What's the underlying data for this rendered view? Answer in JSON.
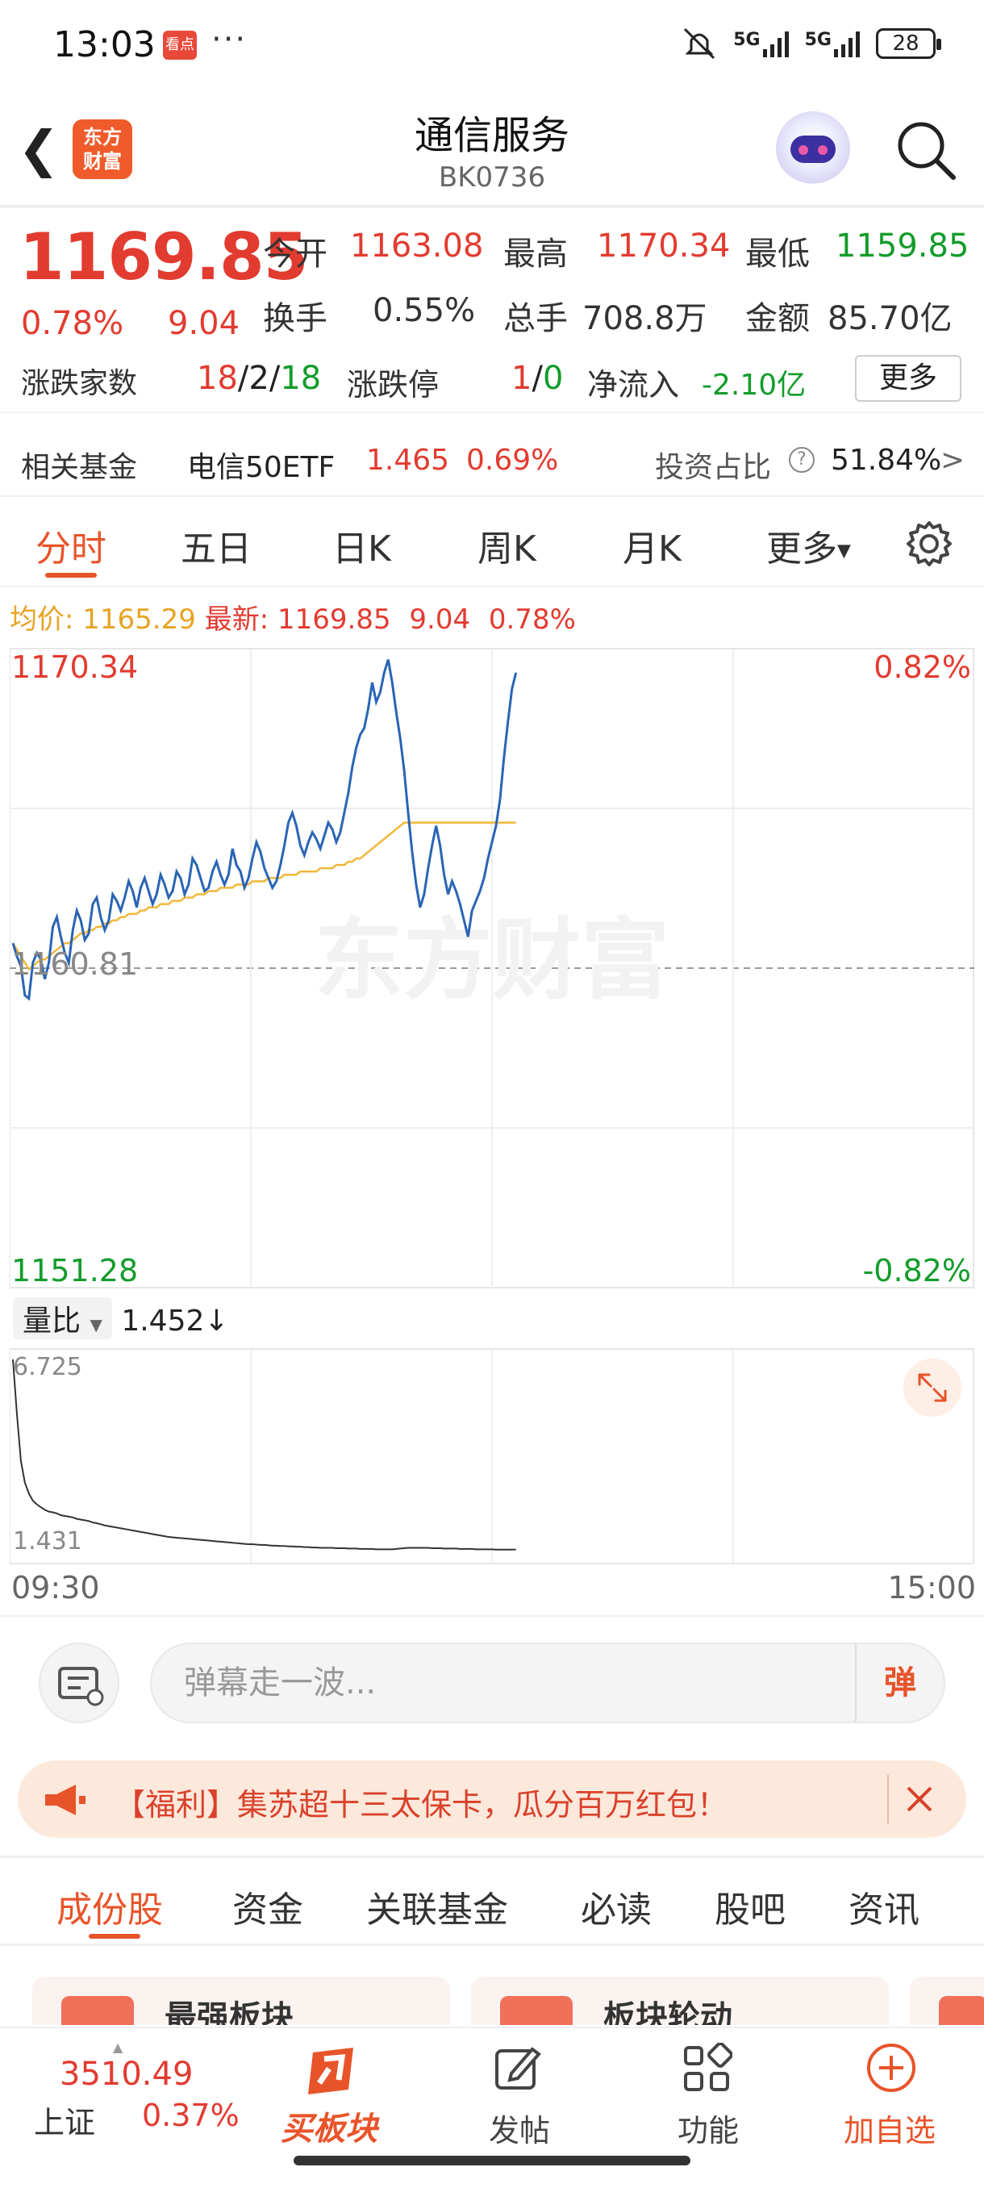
{
  "status_bar": {
    "time": "13:03",
    "app_icon_text": "看点",
    "more": "···",
    "signal1": "5G",
    "signal2": "5G",
    "battery": "28"
  },
  "header": {
    "title": "通信服务",
    "code": "BK0736",
    "logo_line1": "东方",
    "logo_line2": "财富"
  },
  "quote": {
    "price": "1169.85",
    "change_pct": "0.78%",
    "change": "9.04",
    "open_label": "今开",
    "open": "1163.08",
    "high_label": "最高",
    "high": "1170.34",
    "low_label": "最低",
    "low": "1159.85",
    "turnover_label": "换手",
    "turnover": "0.55%",
    "volume_label": "总手",
    "volume": "708.8万",
    "amount_label": "金额",
    "amount": "85.70亿",
    "breadth_label": "涨跌家数",
    "up_count": "18",
    "flat_count": "2",
    "down_count": "18",
    "limit_label": "涨跌停",
    "limit_up": "1",
    "limit_down": "0",
    "netflow_label": "净流入",
    "netflow": "-2.10亿",
    "more_label": "更多"
  },
  "fund": {
    "label": "相关基金",
    "name": "电信50ETF",
    "price": "1.465",
    "pct": "0.69%",
    "ratio_label": "投资占比",
    "ratio": "51.84%",
    "arrow": ">"
  },
  "tabs": [
    "分时",
    "五日",
    "日K",
    "周K",
    "月K",
    "更多"
  ],
  "legend": {
    "avg_label": "均价:",
    "avg": "1165.29",
    "last_label": "最新:",
    "last": "1169.85",
    "change": "9.04",
    "pct": "0.78%"
  },
  "chart_data": {
    "type": "line",
    "ylim": [
      1151.28,
      1170.34
    ],
    "ytick_top": "1170.34",
    "ytick_mid": "1160.81",
    "ytick_bottom": "1151.28",
    "pct_top": "0.82%",
    "pct_bottom": "-0.82%",
    "watermark": "东方财富",
    "x_start": "09:30",
    "x_end": "15:00",
    "total_minutes": 240,
    "series": [
      {
        "values": [
          1161.6,
          1161.2,
          1160.9,
          1160.0,
          1159.9,
          1161.0,
          1161.3,
          1161.1,
          1160.5,
          1161.0,
          1162.1,
          1162.4,
          1161.8,
          1161.3,
          1161.0,
          1162.0,
          1162.6,
          1162.3,
          1161.7,
          1161.9,
          1162.8,
          1163.0,
          1162.4,
          1162.0,
          1162.3,
          1163.1,
          1162.9,
          1162.6,
          1163.0,
          1163.5,
          1163.2,
          1162.7,
          1163.3,
          1163.6,
          1163.2,
          1162.8,
          1163.1,
          1163.7,
          1163.4,
          1163.0,
          1163.2,
          1163.8,
          1163.6,
          1163.1,
          1163.4,
          1164.2,
          1164.0,
          1163.6,
          1163.2,
          1163.3,
          1163.8,
          1164.1,
          1163.7,
          1163.4,
          1163.7,
          1164.5,
          1164.0,
          1163.8,
          1163.3,
          1163.6,
          1164.2,
          1164.7,
          1164.4,
          1163.9,
          1163.6,
          1163.3,
          1163.5,
          1164.0,
          1164.6,
          1165.3,
          1165.6,
          1165.2,
          1164.6,
          1164.3,
          1164.7,
          1165.0,
          1164.8,
          1164.5,
          1164.9,
          1165.3,
          1165.1,
          1164.7,
          1165.0,
          1165.6,
          1166.2,
          1167.0,
          1167.6,
          1168.0,
          1168.2,
          1168.8,
          1169.6,
          1169.0,
          1169.3,
          1169.9,
          1170.3,
          1169.6,
          1168.7,
          1167.9,
          1166.9,
          1165.6,
          1164.4,
          1163.4,
          1162.7,
          1163.1,
          1163.9,
          1164.6,
          1165.2,
          1164.6,
          1163.7,
          1163.1,
          1163.5,
          1163.2,
          1162.8,
          1162.3,
          1161.8,
          1162.6,
          1162.9,
          1163.2,
          1163.6,
          1164.2,
          1164.7,
          1165.2,
          1166.0,
          1167.3,
          1168.4,
          1169.4,
          1169.9
        ],
        "color": "#2a64b5"
      },
      {
        "name_hidden": true,
        "values": [
          1161.6,
          1161.4,
          1161.2,
          1161.0,
          1160.8,
          1160.9,
          1161.0,
          1161.1,
          1161.1,
          1161.2,
          1161.3,
          1161.4,
          1161.5,
          1161.6,
          1161.6,
          1161.7,
          1161.8,
          1161.9,
          1161.9,
          1162.0,
          1162.0,
          1162.1,
          1162.1,
          1162.2,
          1162.2,
          1162.3,
          1162.3,
          1162.4,
          1162.4,
          1162.5,
          1162.5,
          1162.5,
          1162.6,
          1162.6,
          1162.7,
          1162.7,
          1162.7,
          1162.8,
          1162.8,
          1162.8,
          1162.9,
          1162.9,
          1162.9,
          1163.0,
          1163.0,
          1163.0,
          1163.1,
          1163.1,
          1163.1,
          1163.2,
          1163.2,
          1163.2,
          1163.3,
          1163.3,
          1163.3,
          1163.3,
          1163.4,
          1163.4,
          1163.4,
          1163.4,
          1163.5,
          1163.5,
          1163.5,
          1163.5,
          1163.6,
          1163.6,
          1163.6,
          1163.6,
          1163.7,
          1163.7,
          1163.7,
          1163.7,
          1163.8,
          1163.8,
          1163.8,
          1163.8,
          1163.8,
          1163.9,
          1163.9,
          1163.9,
          1163.9,
          1164.0,
          1164.0,
          1164.0,
          1164.1,
          1164.1,
          1164.2,
          1164.2,
          1164.3,
          1164.4,
          1164.5,
          1164.6,
          1164.7,
          1164.8,
          1164.9,
          1165.0,
          1165.1,
          1165.2,
          1165.3,
          1165.3,
          1165.3,
          1165.3,
          1165.3,
          1165.3,
          1165.3,
          1165.3,
          1165.3,
          1165.3,
          1165.3,
          1165.3,
          1165.3,
          1165.3,
          1165.3,
          1165.3,
          1165.3,
          1165.3,
          1165.3,
          1165.3,
          1165.3,
          1165.3,
          1165.3,
          1165.3,
          1165.3,
          1165.3,
          1165.3,
          1165.3,
          1165.3
        ],
        "color": "#f0b83a"
      }
    ]
  },
  "volume_ratio": {
    "label": "量比",
    "value": "1.452",
    "arrow": "↓",
    "ytick_top": "6.725",
    "ytick_bottom": "1.431",
    "ylim": [
      1.2,
      6.9
    ],
    "values": [
      6.7,
      5.2,
      3.9,
      3.3,
      3.0,
      2.8,
      2.7,
      2.62,
      2.55,
      2.5,
      2.48,
      2.45,
      2.4,
      2.38,
      2.36,
      2.34,
      2.3,
      2.28,
      2.26,
      2.24,
      2.2,
      2.18,
      2.15,
      2.12,
      2.1,
      2.08,
      2.06,
      2.04,
      2.02,
      2.0,
      1.98,
      1.96,
      1.94,
      1.92,
      1.9,
      1.88,
      1.86,
      1.84,
      1.82,
      1.8,
      1.79,
      1.78,
      1.77,
      1.76,
      1.75,
      1.74,
      1.73,
      1.72,
      1.71,
      1.7,
      1.69,
      1.68,
      1.67,
      1.66,
      1.65,
      1.64,
      1.63,
      1.62,
      1.61,
      1.6,
      1.6,
      1.59,
      1.58,
      1.58,
      1.57,
      1.56,
      1.56,
      1.55,
      1.55,
      1.54,
      1.54,
      1.53,
      1.53,
      1.52,
      1.52,
      1.51,
      1.51,
      1.5,
      1.5,
      1.5,
      1.5,
      1.49,
      1.49,
      1.49,
      1.48,
      1.48,
      1.48,
      1.47,
      1.47,
      1.47,
      1.47,
      1.46,
      1.46,
      1.46,
      1.46,
      1.46,
      1.47,
      1.48,
      1.49,
      1.5,
      1.5,
      1.5,
      1.5,
      1.5,
      1.5,
      1.49,
      1.49,
      1.49,
      1.48,
      1.48,
      1.48,
      1.48,
      1.47,
      1.47,
      1.47,
      1.47,
      1.46,
      1.46,
      1.46,
      1.46,
      1.46,
      1.45,
      1.45,
      1.45,
      1.45,
      1.45,
      1.452
    ]
  },
  "comment": {
    "placeholder": "弹幕走一波...",
    "send": "弹"
  },
  "banner": {
    "text": "【福利】集苏超十三太保卡，瓜分百万红包！"
  },
  "bottom_tabs": [
    "成份股",
    "资金",
    "关联基金",
    "必读",
    "股吧",
    "资讯"
  ],
  "cards": [
    "最强板块",
    "板块轮动"
  ],
  "bottom_bar": {
    "index_value": "3510.49",
    "index_name": "上证",
    "index_pct": "0.37%",
    "buy_label": "买板块",
    "post_label": "发帖",
    "func_label": "功能",
    "add_label": "加自选"
  },
  "colors": {
    "up": "#e23b30",
    "down": "#139c2b",
    "accent": "#e8542a",
    "line": "#2a64b5",
    "avg": "#f0b83a"
  }
}
